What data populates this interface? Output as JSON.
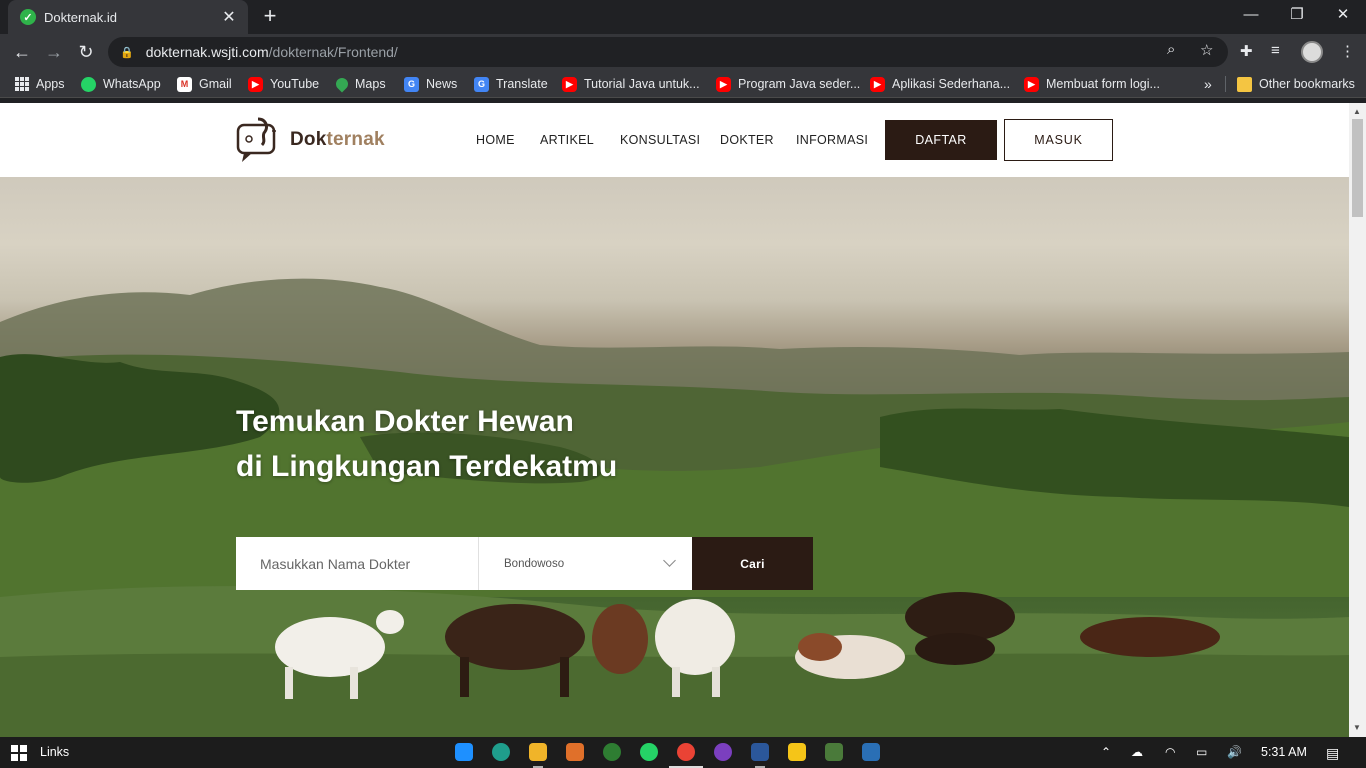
{
  "browser": {
    "tab_title": "Dokternak.id",
    "url_domain": "dokternak.wsjti.com",
    "url_path": "/dokternak/Frontend/",
    "bookmarks": [
      {
        "label": "Apps",
        "icon": "apps-icon"
      },
      {
        "label": "WhatsApp",
        "icon": "whatsapp-icon"
      },
      {
        "label": "Gmail",
        "icon": "gmail-icon"
      },
      {
        "label": "YouTube",
        "icon": "youtube-icon"
      },
      {
        "label": "Maps",
        "icon": "maps-icon"
      },
      {
        "label": "News",
        "icon": "news-icon"
      },
      {
        "label": "Translate",
        "icon": "translate-icon"
      },
      {
        "label": "Tutorial Java untuk...",
        "icon": "youtube-icon"
      },
      {
        "label": "Program Java seder...",
        "icon": "youtube-icon"
      },
      {
        "label": "Aplikasi Sederhana...",
        "icon": "youtube-icon"
      },
      {
        "label": "Membuat form logi...",
        "icon": "youtube-icon"
      }
    ],
    "overflow": "»",
    "other_bookmarks": "Other bookmarks"
  },
  "site": {
    "logo_dok": "Dok",
    "logo_ternak": "ternak",
    "nav": [
      "HOME",
      "ARTIKEL",
      "KONSULTASI",
      "DOKTER",
      "INFORMASI"
    ],
    "register_label": "DAFTAR",
    "login_label": "MASUK",
    "accent_color": "#2b1b14"
  },
  "hero": {
    "line1": "Temukan Dokter Hewan",
    "line2": "di Lingkungan Terdekatmu",
    "search_placeholder": "Masukkan Nama Dokter",
    "location_selected": "Bondowoso",
    "search_button": "Cari"
  },
  "taskbar": {
    "toolbar_label": "Links",
    "time": "5:31 AM"
  }
}
